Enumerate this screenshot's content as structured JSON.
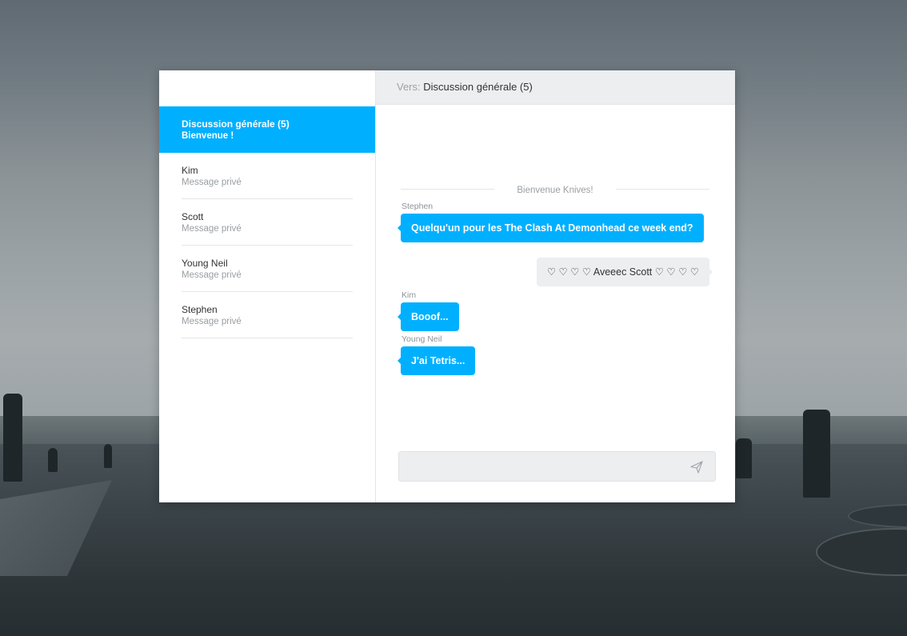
{
  "sidebar": {
    "conversations": [
      {
        "name": "Discussion générale (5)",
        "subtitle": "Bienvenue !",
        "active": true
      },
      {
        "name": "Kim",
        "subtitle": "Message privé",
        "active": false
      },
      {
        "name": "Scott",
        "subtitle": "Message privé",
        "active": false
      },
      {
        "name": "Young Neil",
        "subtitle": "Message privé",
        "active": false
      },
      {
        "name": "Stephen",
        "subtitle": "Message privé",
        "active": false
      }
    ]
  },
  "header": {
    "to_label": "Vers:",
    "to_value": "Discussion générale (5)"
  },
  "chat": {
    "notice": "Bienvenue Knives!",
    "messages": [
      {
        "author": "Stephen",
        "text": "Quelqu'un pour les The Clash At Demonhead ce week end?",
        "direction": "in"
      },
      {
        "author": "",
        "text": "♡ ♡ ♡ ♡ Aveeec Scott ♡ ♡ ♡ ♡",
        "direction": "out"
      },
      {
        "author": "Kim",
        "text": "Booof...",
        "direction": "in"
      },
      {
        "author": "Young Neil",
        "text": "J'ai Tetris...",
        "direction": "in"
      }
    ]
  },
  "composer": {
    "placeholder": "",
    "send_icon": "send-paper-plane-icon"
  },
  "colors": {
    "accent": "#00b0ff",
    "header_bg": "#eceef0",
    "bubble_out_bg": "#eceef0"
  }
}
